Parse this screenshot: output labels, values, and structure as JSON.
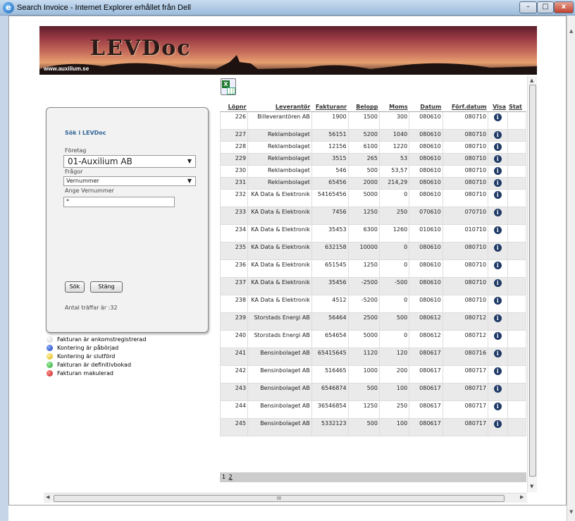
{
  "window": {
    "title": "Search Invoice - Internet Explorer erhållet från Dell",
    "min": "–",
    "max": "□",
    "close": "x"
  },
  "banner": {
    "logo": "LEVDoc",
    "url": "www.auxilium.se"
  },
  "panel": {
    "title": "Sök i LEVDoc",
    "foretag_label": "Företag",
    "foretag_value": "01-Auxilium AB",
    "fragor_label": "Frågor",
    "fragor_value": "Vernummer",
    "ange_label": "Ange Vernummer",
    "ange_value": "*",
    "sok_button": "Sök",
    "stang_button": "Stäng",
    "antal": "Antal träffar är :32"
  },
  "legend": [
    {
      "label": "Fakturan är ankomstregistrerad",
      "color": "#c8c8c8"
    },
    {
      "label": "Kontering är påbörjad",
      "color": "#1533b0"
    },
    {
      "label": "Kontering är slutförd",
      "color": "#e0b000"
    },
    {
      "label": "Fakturan är definitivbokad",
      "color": "#1e9e2a"
    },
    {
      "label": "Fakturan makulerad",
      "color": "#c01515"
    }
  ],
  "table": {
    "columns": [
      "Löpnr",
      "Leverantör",
      "Fakturanr",
      "Belopp",
      "Moms",
      "Datum",
      "Förf.datum",
      "Visa",
      "Stat"
    ],
    "rows": [
      {
        "lopnr": "226",
        "lev": "Billeverantören AB",
        "faktnr": "1900",
        "belopp": "1500",
        "moms": "300",
        "datum": "080610",
        "forf": "080710"
      },
      {
        "lopnr": "227",
        "lev": "Reklambolaget",
        "faktnr": "56151",
        "belopp": "5200",
        "moms": "1040",
        "datum": "080610",
        "forf": "080710"
      },
      {
        "lopnr": "228",
        "lev": "Reklambolaget",
        "faktnr": "12156",
        "belopp": "6100",
        "moms": "1220",
        "datum": "080610",
        "forf": "080710"
      },
      {
        "lopnr": "229",
        "lev": "Reklambolaget",
        "faktnr": "3515",
        "belopp": "265",
        "moms": "53",
        "datum": "080610",
        "forf": "080710"
      },
      {
        "lopnr": "230",
        "lev": "Reklambolaget",
        "faktnr": "546",
        "belopp": "500",
        "moms": "53,57",
        "datum": "080610",
        "forf": "080710"
      },
      {
        "lopnr": "231",
        "lev": "Reklambolaget",
        "faktnr": "65456",
        "belopp": "2000",
        "moms": "214,29",
        "datum": "080610",
        "forf": "080710"
      },
      {
        "lopnr": "232",
        "lev": "KA Data & Elektronik",
        "faktnr": "54165456",
        "belopp": "5000",
        "moms": "0",
        "datum": "080610",
        "forf": "080710"
      },
      {
        "lopnr": "233",
        "lev": "KA Data & Elektronik",
        "faktnr": "7456",
        "belopp": "1250",
        "moms": "250",
        "datum": "070610",
        "forf": "070710"
      },
      {
        "lopnr": "234",
        "lev": "KA Data & Elektronik",
        "faktnr": "35453",
        "belopp": "6300",
        "moms": "1260",
        "datum": "010610",
        "forf": "010710"
      },
      {
        "lopnr": "235",
        "lev": "KA Data & Elektronik",
        "faktnr": "632158",
        "belopp": "10000",
        "moms": "0",
        "datum": "080610",
        "forf": "080710"
      },
      {
        "lopnr": "236",
        "lev": "KA Data & Elektronik",
        "faktnr": "651545",
        "belopp": "1250",
        "moms": "0",
        "datum": "080610",
        "forf": "080710"
      },
      {
        "lopnr": "237",
        "lev": "KA Data & Elektronik",
        "faktnr": "35456",
        "belopp": "-2500",
        "moms": "-500",
        "datum": "080610",
        "forf": "080710"
      },
      {
        "lopnr": "238",
        "lev": "KA Data & Elektronik",
        "faktnr": "4512",
        "belopp": "-5200",
        "moms": "0",
        "datum": "080610",
        "forf": "080710"
      },
      {
        "lopnr": "239",
        "lev": "Storstads Energi AB",
        "faktnr": "56464",
        "belopp": "2500",
        "moms": "500",
        "datum": "080612",
        "forf": "080712"
      },
      {
        "lopnr": "240",
        "lev": "Storstads Energi AB",
        "faktnr": "654654",
        "belopp": "5000",
        "moms": "0",
        "datum": "080612",
        "forf": "080712"
      },
      {
        "lopnr": "241",
        "lev": "Bensinbolaget AB",
        "faktnr": "65415645",
        "belopp": "1120",
        "moms": "120",
        "datum": "080617",
        "forf": "080716"
      },
      {
        "lopnr": "242",
        "lev": "Bensinbolaget AB",
        "faktnr": "516465",
        "belopp": "1000",
        "moms": "200",
        "datum": "080617",
        "forf": "080717"
      },
      {
        "lopnr": "243",
        "lev": "Bensinbolaget AB",
        "faktnr": "6546874",
        "belopp": "500",
        "moms": "100",
        "datum": "080617",
        "forf": "080717"
      },
      {
        "lopnr": "244",
        "lev": "Bensinbolaget AB",
        "faktnr": "36546854",
        "belopp": "1250",
        "moms": "250",
        "datum": "080617",
        "forf": "080717"
      },
      {
        "lopnr": "245",
        "lev": "Bensinbolaget AB",
        "faktnr": "5332123",
        "belopp": "500",
        "moms": "100",
        "datum": "080617",
        "forf": "080717"
      }
    ]
  },
  "pager": {
    "page1": "1",
    "page2": "2"
  },
  "scroll": {
    "thumb": "III"
  }
}
